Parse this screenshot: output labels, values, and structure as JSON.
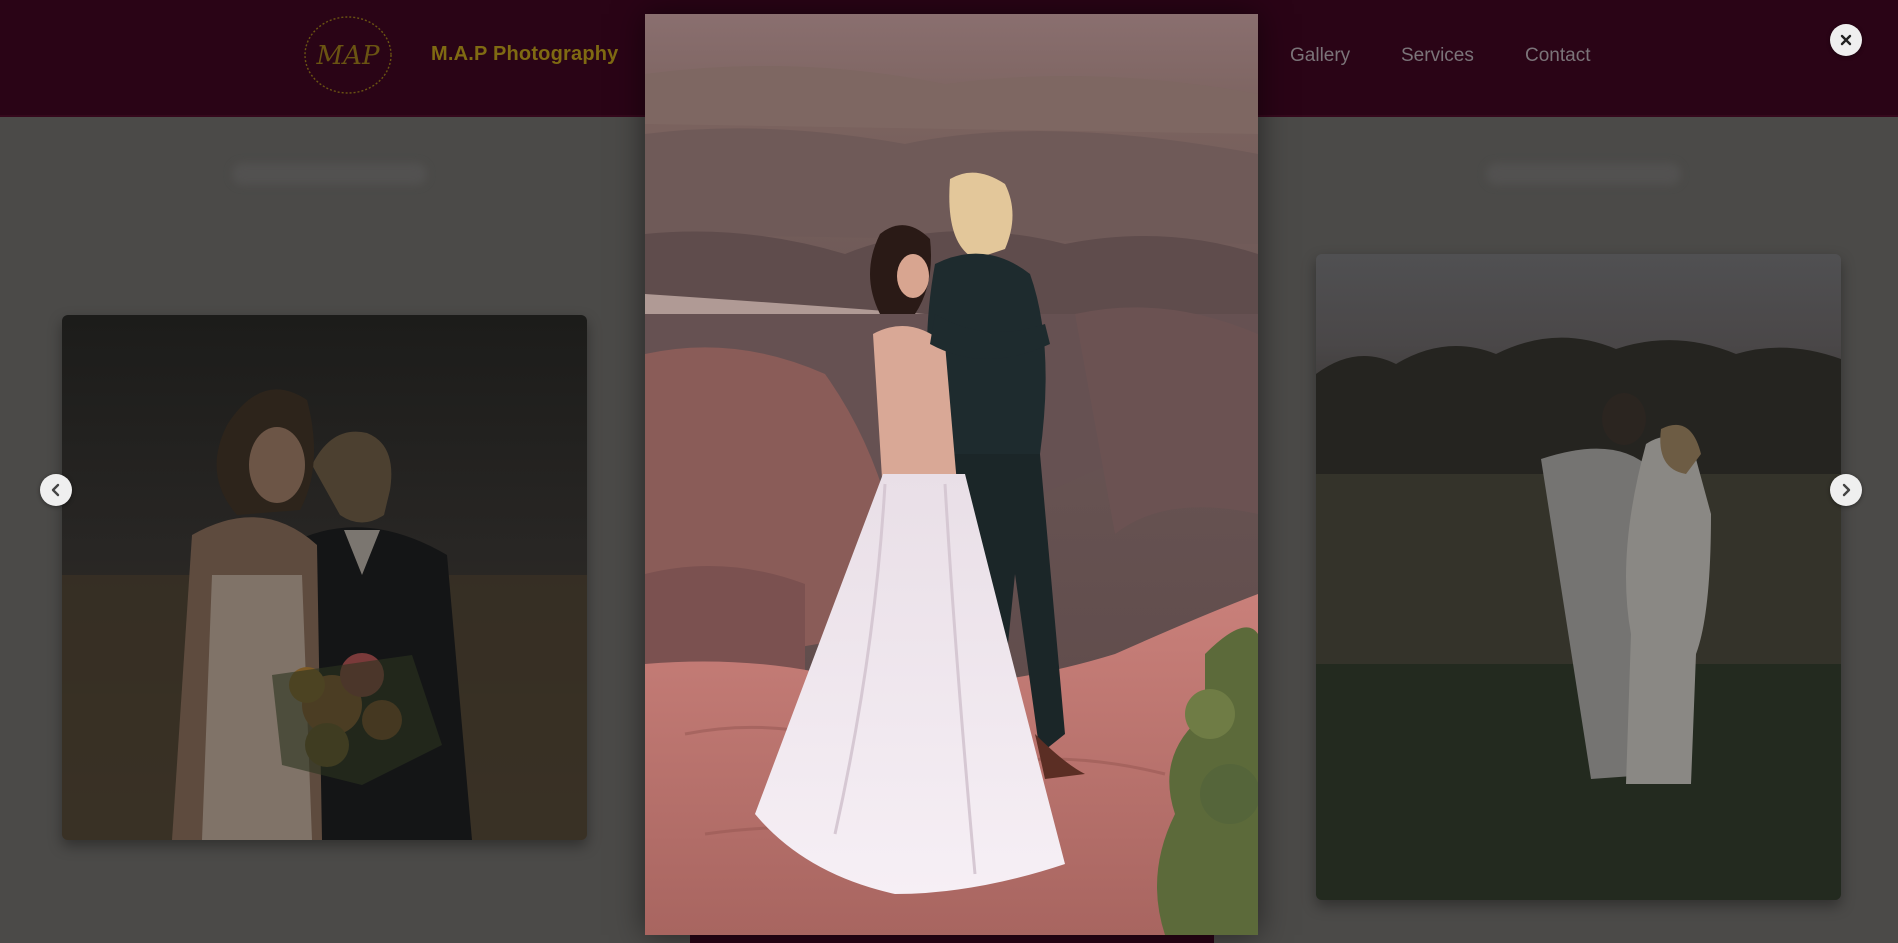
{
  "site": {
    "brand_name": "M.A.P Photography",
    "logo_monogram": "MAP"
  },
  "nav": {
    "links": [
      "Gallery",
      "Services",
      "Contact"
    ]
  },
  "lightbox": {
    "image_icon": "wedding-couple-canyon-photo",
    "close_icon": "close-icon",
    "prev_icon": "chevron-left-icon",
    "next_icon": "chevron-right-icon"
  },
  "gallery": {
    "cards": [
      {
        "icon": "couple-portrait-photo"
      },
      {
        "icon": "couple-field-sunset-photo"
      }
    ]
  },
  "colors": {
    "navbar_bg": "#2a0416",
    "brand_gold": "#7f6a12",
    "overlay": "#4b4a48",
    "button_bg": "#efefef"
  }
}
